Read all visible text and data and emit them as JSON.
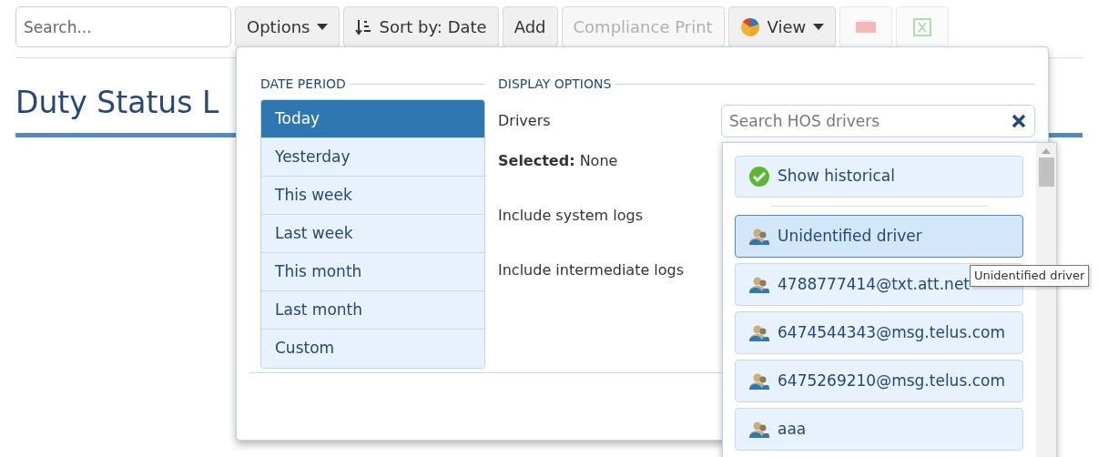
{
  "toolbar": {
    "search": {
      "placeholder": "Search..."
    },
    "buttons": [
      {
        "kind": "dropdown",
        "label": "Options",
        "disabled": false
      },
      {
        "kind": "sort",
        "label": "Sort by: Date",
        "disabled": false
      },
      {
        "kind": "plain",
        "label": "Add",
        "disabled": false
      },
      {
        "kind": "plain",
        "label": "Compliance Print",
        "disabled": true
      },
      {
        "kind": "view",
        "label": "View",
        "disabled": false
      },
      {
        "kind": "pdf",
        "disabled": true
      },
      {
        "kind": "excel",
        "disabled": true
      }
    ]
  },
  "page_title": "Duty Status L",
  "options_panel": {
    "date_period": {
      "title": "DATE PERIOD",
      "items": [
        {
          "label": "Today",
          "selected": true
        },
        {
          "label": "Yesterday",
          "selected": false
        },
        {
          "label": "This week",
          "selected": false
        },
        {
          "label": "Last week",
          "selected": false
        },
        {
          "label": "This month",
          "selected": false
        },
        {
          "label": "Last month",
          "selected": false
        },
        {
          "label": "Custom",
          "selected": false
        }
      ]
    },
    "display_options": {
      "title": "DISPLAY OPTIONS",
      "drivers_label": "Drivers",
      "driver_search": {
        "placeholder": "Search HOS drivers"
      },
      "selected_text": "**Selected:** None",
      "options": [
        "Include system logs",
        "Include intermediate logs"
      ]
    }
  },
  "driver_list": {
    "show_historical": {
      "label": "Show historical",
      "checked": true
    },
    "items": [
      {
        "label": "Unidentified driver",
        "selected": true
      },
      {
        "label": "4788777414@txt.att.net",
        "selected": false
      },
      {
        "label": "6474544343@msg.telus.com",
        "selected": false
      },
      {
        "label": "6475269210@msg.telus.com",
        "selected": false
      },
      {
        "label": "aaa",
        "selected": false
      }
    ],
    "tooltip": "Unidentified driver"
  }
}
